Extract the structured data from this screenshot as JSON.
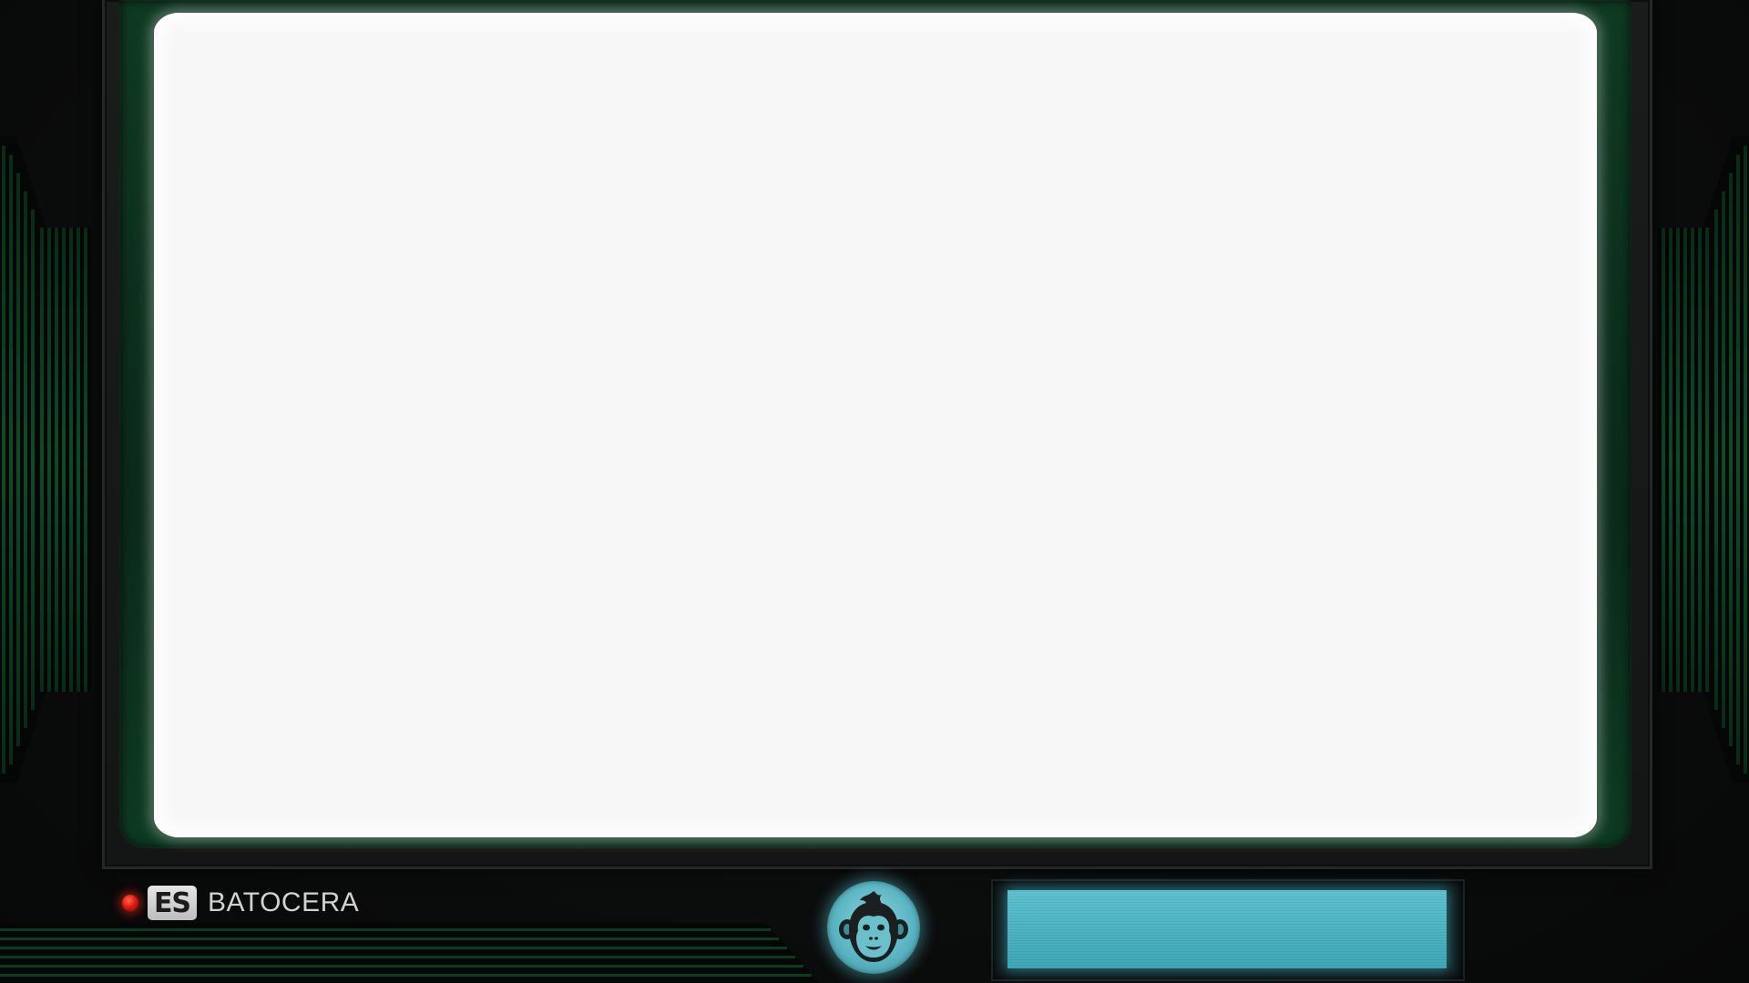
{
  "app": {
    "brand_logo": "ES",
    "brand_name": "BATOCERA"
  },
  "colors": {
    "screen": "#f7f7f7",
    "bezel_green": "#0f3a23",
    "power_led": "#e31b0e",
    "accent_cyan": "#5fc3d1"
  },
  "icons": {
    "power": "power-led-icon",
    "avatar": "monkey-head-icon"
  }
}
